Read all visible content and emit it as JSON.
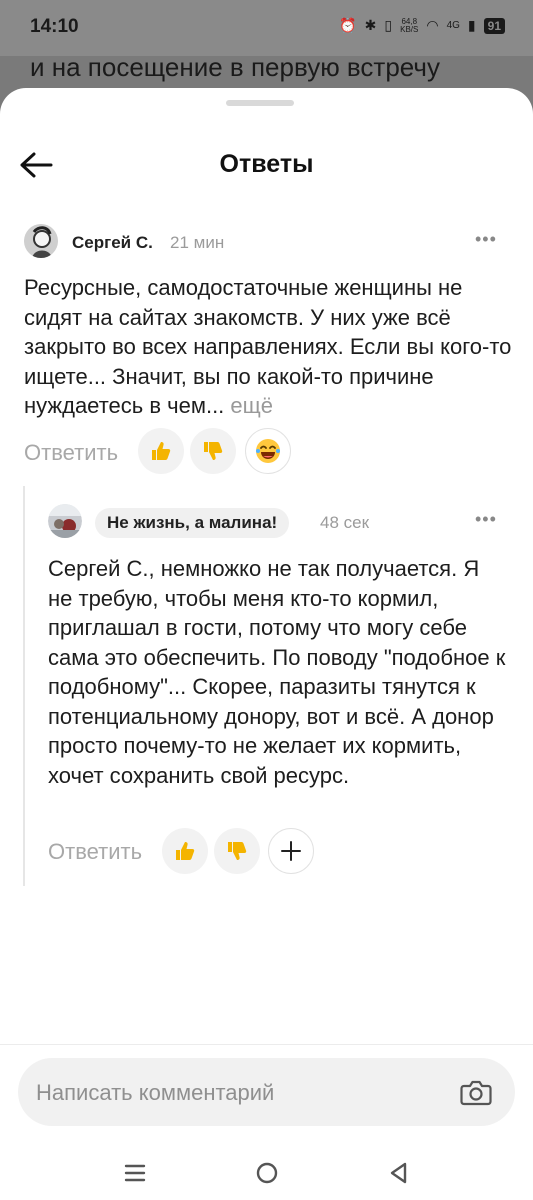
{
  "status_bar": {
    "time": "14:10",
    "net_speed_value": "64,8",
    "net_speed_unit": "KB/S",
    "network": "4G",
    "battery": "91"
  },
  "background_text": "и на посещение в первую встречу",
  "header": {
    "title": "Ответы"
  },
  "comment": {
    "author": "Сергей С.",
    "time": "21 мин",
    "text": "Ресурсные, самодостаточные женщины не сидят на сайтах знакомств. У них уже всё закрыто во всех направлениях. Если вы кого-то ищете... Значит, вы по какой-то причине нуждаетесь в чем...",
    "more_label": "ещё",
    "reply_label": "Ответить"
  },
  "reply": {
    "author": "Не жизнь, а малина!",
    "time": "48 сек",
    "text": "Сергей С., немножко не так получается. Я не требую, чтобы меня кто-то кормил, приглашал в гости, потому что могу себе сама это обеспечить. По поводу \"подобное к подобному\"... Скорее, паразиты тянутся к потенциальному донору, вот и всё. А донор просто почему-то не желает их кормить, хочет сохранить свой ресурс.",
    "reply_label": "Ответить"
  },
  "composer": {
    "placeholder": "Написать комментарий"
  },
  "icons": {
    "back": "arrow-left-icon",
    "more": "more-horizontal-icon",
    "like": "thumbs-up-icon",
    "dislike": "thumbs-down-icon",
    "laugh": "laughing-emoji-icon",
    "add_reaction": "plus-icon",
    "camera": "camera-icon"
  },
  "colors": {
    "like": "#f4b400",
    "dislike": "#f4b400",
    "sheet": "#ffffff",
    "overlay": "#7a7a7a"
  }
}
